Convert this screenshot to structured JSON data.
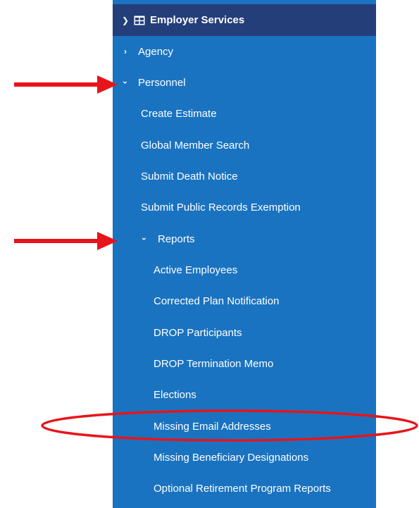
{
  "menu": {
    "header": {
      "label": "Employer Services",
      "icon": "table-grid-icon"
    },
    "items": [
      {
        "label": "Agency",
        "expanded": false
      },
      {
        "label": "Personnel",
        "expanded": true
      },
      {
        "label": "Create Estimate"
      },
      {
        "label": "Global Member Search"
      },
      {
        "label": "Submit Death Notice"
      },
      {
        "label": "Submit Public Records Exemption"
      },
      {
        "label": "Reports",
        "expanded": true
      },
      {
        "label": "Active Employees"
      },
      {
        "label": "Corrected Plan Notification"
      },
      {
        "label": "DROP Participants"
      },
      {
        "label": "DROP Termination Memo"
      },
      {
        "label": "Elections"
      },
      {
        "label": "Missing Email Addresses"
      },
      {
        "label": "Missing Beneficiary Designations"
      },
      {
        "label": "Optional Retirement Program Reports"
      }
    ]
  },
  "colors": {
    "menu_bg": "#1a73c0",
    "header_bg": "#243e7a",
    "text": "#ffffff",
    "annotation": "#e8141b"
  },
  "annotations": {
    "arrows_point_to": [
      "Personnel",
      "Reports"
    ],
    "circled_item": "Missing Email Addresses"
  }
}
